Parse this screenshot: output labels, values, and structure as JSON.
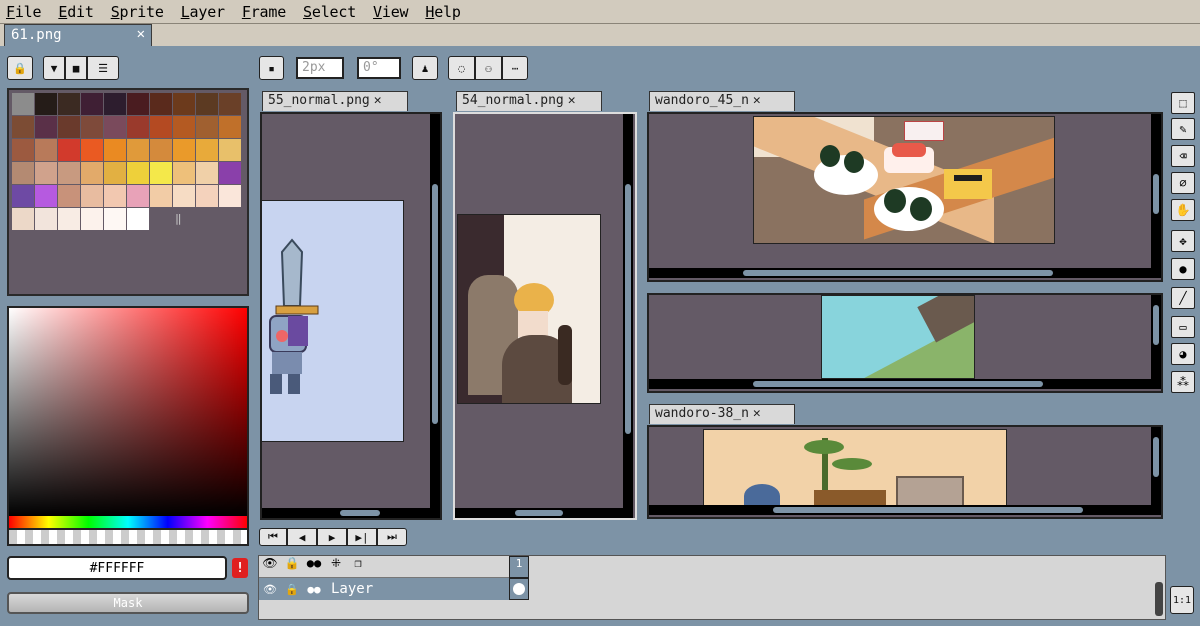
{
  "menu": [
    "File",
    "Edit",
    "Sprite",
    "Layer",
    "Frame",
    "Select",
    "View",
    "Help"
  ],
  "file_tab": {
    "label": "61.png",
    "close": "✕"
  },
  "toolbar": {
    "brush_size": "2px",
    "angle": "0°"
  },
  "palette": {
    "colors": [
      "#8c8c8c",
      "#251c18",
      "#3b2a22",
      "#3f1f34",
      "#2d1d2e",
      "#4a1c20",
      "#5a2a1c",
      "#6c3a1c",
      "#5c3a22",
      "#6a4028",
      "#7c4c34",
      "#5a3048",
      "#6a3a2c",
      "#7e4a3a",
      "#7a4a5c",
      "#9a3a2c",
      "#b44a22",
      "#b45a22",
      "#a06030",
      "#c0702a",
      "#9c5a40",
      "#b87a5a",
      "#d23a2c",
      "#ea5a22",
      "#ea8a22",
      "#e09a3a",
      "#d48a3c",
      "#ea9a2a",
      "#e8aa3a",
      "#e8c06a",
      "#b48a72",
      "#d0a28c",
      "#c89a80",
      "#e2aa6a",
      "#e2b042",
      "#eed03a",
      "#f4e84a",
      "#eec07a",
      "#f0d0a8",
      "#8a40aa",
      "#6e4aa4",
      "#b65ae0",
      "#c8927a",
      "#e8bca0",
      "#f2c8b0",
      "#e8a2b8",
      "#f2cca6",
      "#f6dcc4",
      "#f4d2bc",
      "#fae6da",
      "#ecd8c8",
      "#f2e4dc",
      "#f8ece4",
      "#fcf2ec",
      "#fef8f4",
      "#ffffff"
    ]
  },
  "color_picker": {
    "hex": "#FFFFFF",
    "mask_label": "Mask"
  },
  "docs": [
    {
      "label": "55_normal.png"
    },
    {
      "label": "54_normal.png"
    },
    {
      "label": "wandoro_45_n"
    },
    {
      "label": "wandoro-38_n"
    }
  ],
  "timeline": {
    "layer_name": "Layer",
    "frame_number": "1"
  },
  "zoom_button": "1:1",
  "colors": {
    "accent": "#7d93a6",
    "panel": "#645a66",
    "menubar": "#d2cbbe"
  }
}
